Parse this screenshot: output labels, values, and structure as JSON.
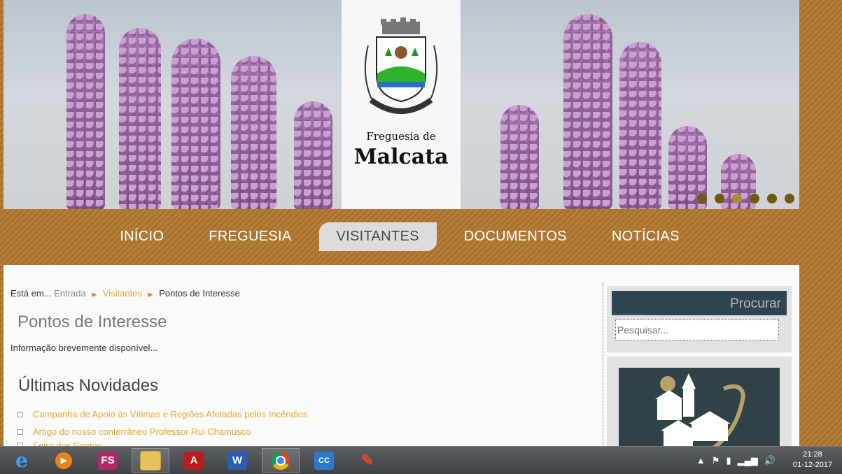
{
  "header": {
    "logo_subtitle": "Freguesia de",
    "logo_title": "Malcata",
    "shield_text": "MALCATA",
    "slider_dots": 6,
    "active_dot": 3
  },
  "nav": {
    "items": [
      {
        "label": "INÍCIO"
      },
      {
        "label": "FREGUESIA"
      },
      {
        "label": "VISITANTES"
      },
      {
        "label": "DOCUMENTOS"
      },
      {
        "label": "NOTÍCIAS"
      }
    ],
    "active": "VISITANTES"
  },
  "breadcrumb": {
    "prefix": "Está em...",
    "items": [
      "Entrada",
      "Visitantes",
      "Pontos de Interesse"
    ]
  },
  "main": {
    "title": "Pontos de Interesse",
    "info": "Informação brevemente disponível...",
    "news_title": "Últimas Novidades",
    "news": [
      "Campanha de Apoio às Vítimas e Regiões Afetadas pelos Incêndios",
      "Artigo do nosso conterrâneo Professor Rui Chamusco",
      "Feira dos Santos"
    ]
  },
  "sidebar": {
    "search_title": "Procurar",
    "search_placeholder": "Pesquisar..."
  },
  "taskbar": {
    "apps": [
      "Internet Explorer",
      "Media Player",
      "FS",
      "File Explorer",
      "Acrobat",
      "Word",
      "Chrome",
      "CC",
      "CCleaner"
    ],
    "time": "21:28",
    "date": "01-12-2017"
  },
  "colors": {
    "accent_link": "#e0a930",
    "nav_active_bg": "#dcdcdc",
    "sidebar_dark": "#2e4550"
  }
}
